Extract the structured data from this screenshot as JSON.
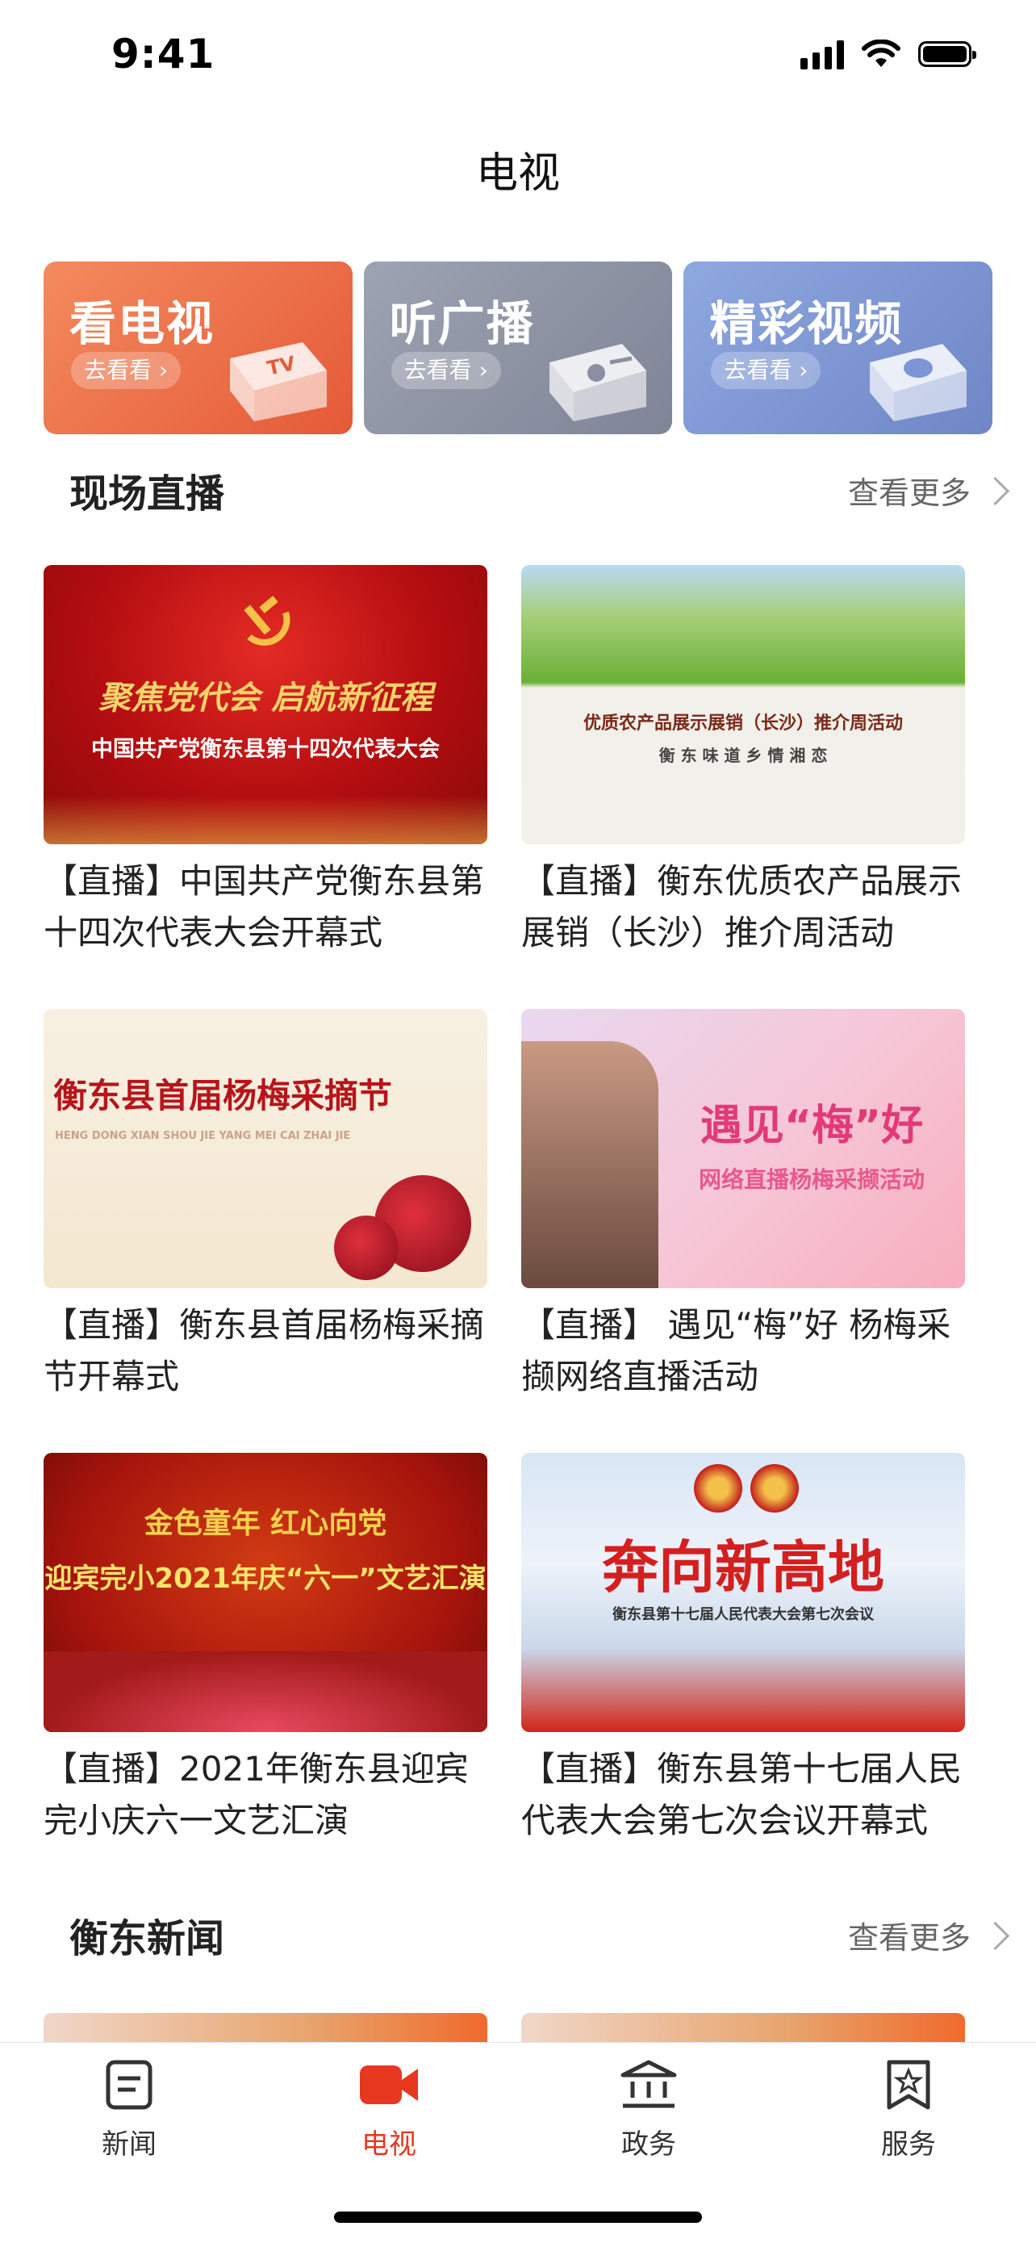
{
  "status": {
    "time": "9:41"
  },
  "header": {
    "title": "电视"
  },
  "categories": [
    {
      "title": "看电视",
      "action": "去看看",
      "icon": "tv-icon",
      "badge": "TV"
    },
    {
      "title": "听广播",
      "action": "去看看",
      "icon": "radio-icon"
    },
    {
      "title": "精彩视频",
      "action": "去看看",
      "icon": "video-play-icon"
    }
  ],
  "live": {
    "title": "现场直播",
    "more": "查看更多",
    "items": [
      {
        "title": "【直播】中国共产党衡东县第十四次代表大会开幕式",
        "thumb_line1": "聚焦党代会 启航新征程",
        "thumb_line2": "中国共产党衡东县第十四次代表大会"
      },
      {
        "title": "【直播】衡东优质农产品展示展销（长沙）推介周活动",
        "thumb_line1": "优质农产品展示展销（长沙）推介周活动",
        "thumb_line2": "衡 东 味 道 乡 情 湘 恋"
      },
      {
        "title": "【直播】衡东县首届杨梅采摘节开幕式",
        "thumb_line1": "衡东县首届杨梅采摘节",
        "thumb_line2": "HENG DONG XIAN SHOU JIE YANG MEI CAI ZHAI JIE"
      },
      {
        "title": "【直播】 遇见“梅”好 杨梅采撷网络直播活动",
        "thumb_line1": "遇见“梅”好",
        "thumb_line2": "网络直播杨梅采撷活动"
      },
      {
        "title": "【直播】2021年衡东县迎宾完小庆六一文艺汇演",
        "thumb_line1": "金色童年  红心向党",
        "thumb_line2": "迎宾完小2021年庆“六一”文艺汇演"
      },
      {
        "title": "【直播】衡东县第十七届人民代表大会第七次会议开幕式",
        "thumb_line1": "奔向新高地",
        "thumb_line2": "衡东县第十七届人民代表大会第七次会议"
      }
    ]
  },
  "news": {
    "title": "衡东新闻",
    "more": "查看更多"
  },
  "tabbar": [
    {
      "label": "新闻",
      "icon": "news-icon",
      "active": false
    },
    {
      "label": "电视",
      "icon": "tv-camera-icon",
      "active": true
    },
    {
      "label": "政务",
      "icon": "government-icon",
      "active": false
    },
    {
      "label": "服务",
      "icon": "service-icon",
      "active": false
    }
  ],
  "colors": {
    "accent": "#e8371f"
  }
}
